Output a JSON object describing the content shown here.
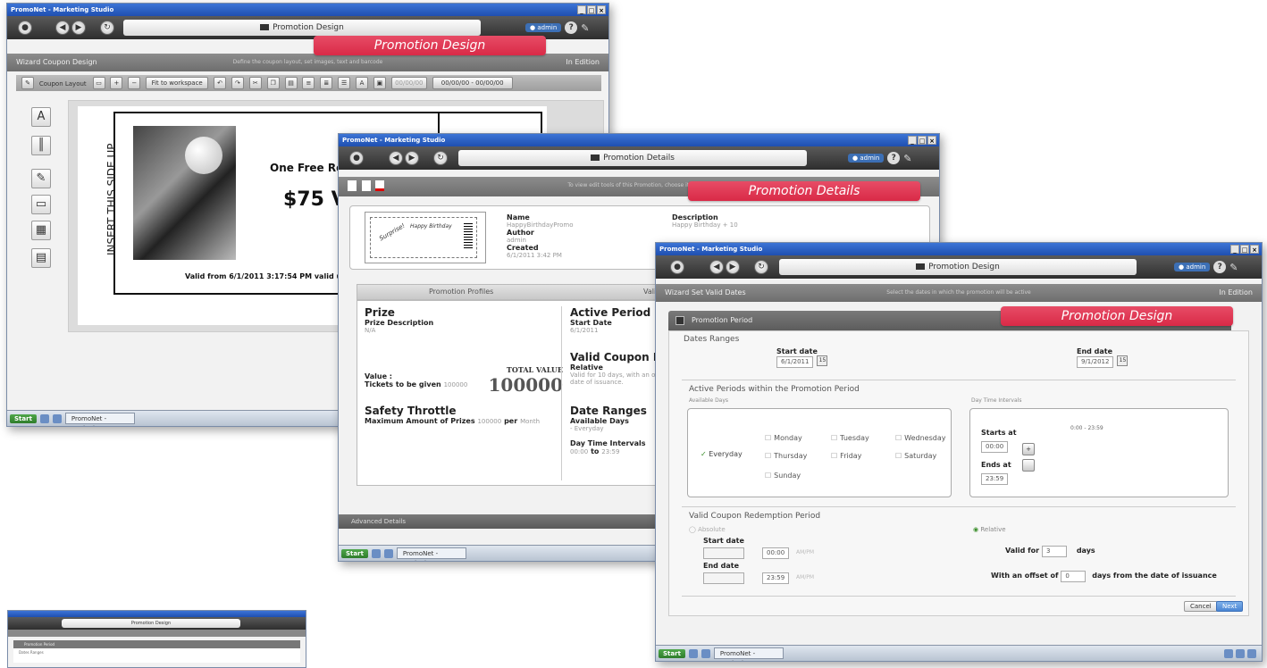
{
  "window1": {
    "titlebar": "PromoNet - Marketing Studio",
    "header_title": "Promotion Design",
    "sub_left": "Wizard Coupon Design",
    "sub_mid": "Define the coupon layout, set images, text and barcode",
    "sub_right": "In Edition",
    "banner": "Promotion Design",
    "toolbar": {
      "layout_label": "Coupon Layout",
      "zoom_select": "Fit to workspace",
      "date_range": "00/00/00 - 00/00/00",
      "date_left": "00/00/00"
    },
    "coupon": {
      "side_text": "INSERT THIS SIDE UP",
      "headline": "One Free Ro",
      "value": "$75 V",
      "valid_line": "Valid from 6/1/2011 3:17:54 PM valid until"
    },
    "taskbar_item": "PromoNet - Marketin..."
  },
  "window2": {
    "titlebar": "PromoNet - Marketing Studio",
    "header_title": "Promotion Details",
    "sub_mid": "To view edit tools of this Promotion, choose its status",
    "banner": "Promotion Details",
    "summary": {
      "name_label": "Name",
      "name_value": "HappyBirthdayPromo",
      "author_label": "Author",
      "author_value": "admin",
      "created_label": "Created",
      "created_value": "6/1/2011 3:42 PM",
      "description_label": "Description",
      "description_value": "Happy Birthday + 10"
    },
    "ticket": {
      "line1": "Surprise!",
      "line2": "Happy Birthday"
    },
    "tabs": [
      "Promotion Profiles",
      "Valid Da"
    ],
    "prize": {
      "title": "Prize",
      "desc_label": "Prize Description",
      "desc_value": "N/A",
      "value_label": "Value :",
      "tickets_label": "Tickets to be given",
      "tickets_value": "100000",
      "total_label": "TOTAL VALUE",
      "total_value": "100000"
    },
    "throttle": {
      "title": "Safety Throttle",
      "line_label": "Maximum Amount of Prizes",
      "line_value": "100000",
      "per_label": "per",
      "per_value": "Month"
    },
    "active": {
      "title": "Active Period",
      "start_label": "Start Date",
      "start_value": "6/1/2011"
    },
    "valid": {
      "title": "Valid Coupon Redem",
      "rel_label": "Relative",
      "rel_text": "Valid for 10 days, with an offse",
      "rel_text2": "date of issuance."
    },
    "dates": {
      "title": "Date Ranges",
      "avail_label": "Available Days",
      "avail_value": "- Everyday",
      "dti_label": "Day Time Intervals",
      "dti_from": "00:00",
      "dti_to_word": "to",
      "dti_to": "23:59"
    },
    "footer_link": "Advanced Details",
    "taskbar_item": "PromoNet - Marketin..."
  },
  "window3": {
    "titlebar": "PromoNet - Marketing Studio",
    "header_title": "Promotion Design",
    "sub_left": "Wizard Set Valid Dates",
    "sub_mid": "Select the dates in which the promotion will be active",
    "sub_right": "In Edition",
    "banner": "Promotion Design",
    "period_header": "Promotion Period",
    "dates_ranges": "Dates Ranges",
    "start_label": "Start date",
    "start_value": "6/1/2011",
    "end_label": "End date",
    "end_value": "9/1/2012",
    "active_title": "Active Periods within the Promotion Period",
    "avail_days": "Available Days",
    "everyday": "Everyday",
    "days": [
      "Monday",
      "Tuesday",
      "Wednesday",
      "Thursday",
      "Friday",
      "Saturday",
      "Sunday"
    ],
    "dti_title": "Day Time Intervals",
    "starts_at": "Starts at",
    "starts_value": "00:00",
    "interval_text": "0:00 - 23:59",
    "ends_at": "Ends at",
    "ends_value": "23:59",
    "valid_title": "Valid Coupon Redemption Period",
    "absolute": "Absolute",
    "relative": "Relative",
    "abs_start": "Start date",
    "abs_start_time": "00:00",
    "abs_end": "End date",
    "abs_end_time": "23:59",
    "am_pm": "AM/PM",
    "valid_for": "Valid for",
    "valid_for_value": "3",
    "days_word": "days",
    "offset_label": "With an offset of",
    "offset_value": "0",
    "offset_tail": "days from the date of issuance",
    "cancel": "Cancel",
    "next": "Next",
    "taskbar_item": "PromoNet - Marketin..."
  },
  "thumb": {
    "header_title": "Promotion Design",
    "period_header": "Promotion Period",
    "dates": "Dates Ranges"
  },
  "colors": {
    "banner": "#d92a47",
    "header": "#3e3e3e",
    "accent": "#4a86d4"
  }
}
